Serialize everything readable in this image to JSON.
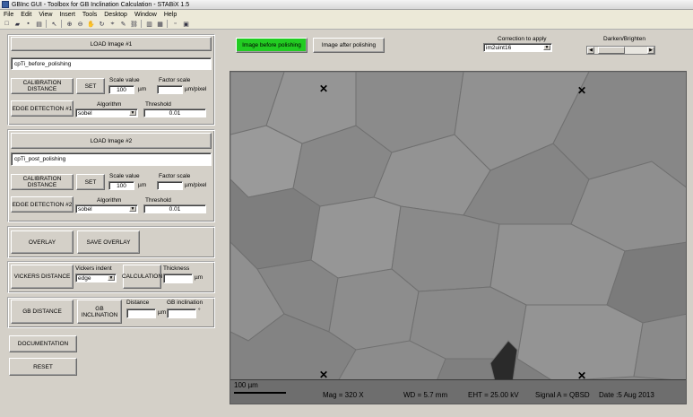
{
  "window": {
    "title": "GBInc GUI - Toolbox for GB Inclination Calculation - STABiX 1.5"
  },
  "menu": [
    "File",
    "Edit",
    "View",
    "Insert",
    "Tools",
    "Desktop",
    "Window",
    "Help"
  ],
  "toolbar_icons": [
    "new-file-icon",
    "open-icon",
    "save-icon",
    "print-icon",
    "pointer-icon",
    "zoom-in-icon",
    "zoom-out-icon",
    "pan-icon",
    "rotate-icon",
    "datacursor-icon",
    "brush-icon",
    "link-icon",
    "colorbar-icon",
    "legend-icon",
    "hide-plot-icon",
    "show-plot-icon"
  ],
  "image1": {
    "load_label": "LOAD Image #1",
    "filename": "cpTi_before_polishing",
    "calibration_label": "CALIBRATION DISTANCE",
    "set_label": "SET",
    "scale_value_label": "Scale value",
    "scale_value": "100",
    "scale_unit": "µm",
    "factor_scale_label": "Factor scale",
    "factor_unit": "µm/pixel",
    "edge_label": "EDGE DETECTION #1",
    "algorithm_label": "Algorithm",
    "algorithm_value": "sobel",
    "threshold_label": "Threshold",
    "threshold_value": "0.01"
  },
  "image2": {
    "load_label": "LOAD Image #2",
    "filename": "cpTi_post_polishing",
    "calibration_label": "CALIBRATION DISTANCE",
    "set_label": "SET",
    "scale_value_label": "Scale value",
    "scale_value": "100",
    "scale_unit": "µm",
    "factor_scale_label": "Factor scale",
    "factor_unit": "µm/pixel",
    "edge_label": "EDGE DETECTION #2",
    "algorithm_label": "Algorithm",
    "algorithm_value": "sobel",
    "threshold_label": "Threshold",
    "threshold_value": "0.01"
  },
  "overlay": {
    "overlay_label": "OVERLAY",
    "save_overlay_label": "SAVE OVERLAY"
  },
  "vickers": {
    "distance_label": "VICKERS DISTANCE",
    "indent_label": "Vickers indent",
    "indent_value": "edge",
    "calculation_label": "CALCULATION",
    "thickness_label": "Thickness",
    "thickness_unit": "µm"
  },
  "gb": {
    "distance_label": "GB DISTANCE",
    "inclination_label": "GB INCLINATION",
    "distance_field_label": "Distance",
    "distance_unit": "µm",
    "inclination_field_label": "GB inclination",
    "inclination_unit": "°"
  },
  "documentation_label": "DOCUMENTATION",
  "reset_label": "RESET",
  "view_toggle": {
    "before_label": "Image before polishing",
    "after_label": "Image after polishing",
    "active_color": "#22cc22"
  },
  "correction": {
    "label": "Correction to apply",
    "value": "im2uint16"
  },
  "darken": {
    "label": "Darken/Brighten"
  },
  "sem_info": {
    "scale": "100 µm",
    "mag": "Mag =     320 X",
    "wd": "WD =  5.7 mm",
    "eht": "EHT = 25.00 kV",
    "signal": "Signal A = QBSD",
    "date": "Date :5 Aug 2013"
  }
}
